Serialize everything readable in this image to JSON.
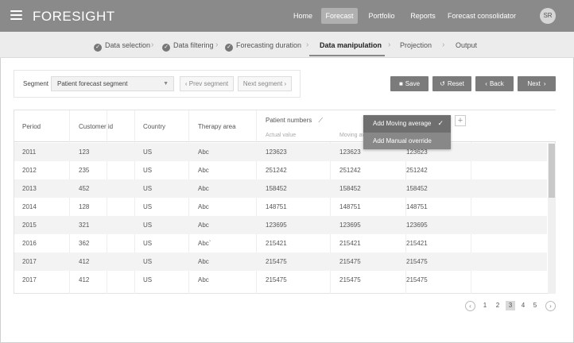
{
  "app": {
    "logo": "FORESIGHT",
    "avatar_initials": "SR"
  },
  "nav": [
    {
      "label": "Home"
    },
    {
      "label": "Forecast",
      "active": true
    },
    {
      "label": "Portfolio"
    },
    {
      "label": "Reports"
    },
    {
      "label": "Forecast consolidator"
    }
  ],
  "steps": [
    {
      "label": "Data selection",
      "done": true
    },
    {
      "label": "Data filtering",
      "done": true
    },
    {
      "label": "Forecasting duration",
      "done": true
    },
    {
      "label": "Data manipulation",
      "current": true
    },
    {
      "label": "Projection"
    },
    {
      "label": "Output"
    }
  ],
  "segment": {
    "label": "Segment",
    "selected": "Patient forecast segment",
    "prev": "Prev segment",
    "next": "Next segment"
  },
  "actions": {
    "save": "Save",
    "reset": "Reset",
    "back": "Back",
    "next": "Next"
  },
  "table": {
    "columns": [
      "Period",
      "Customer id",
      "Country",
      "Therapy area"
    ],
    "group_header": "Patient numbers",
    "sub_columns": [
      "Actual value",
      "Moving av"
    ],
    "rows": [
      [
        "2011",
        "123",
        "US",
        "Abc",
        "123623",
        "123623",
        "123623"
      ],
      [
        "2012",
        "235",
        "US",
        "Abc",
        "251242",
        "251242",
        "251242"
      ],
      [
        "2013",
        "452",
        "US",
        "Abc",
        "158452",
        "158452",
        "158452"
      ],
      [
        "2014",
        "128",
        "US",
        "Abc",
        "148751",
        "148751",
        "148751"
      ],
      [
        "2015",
        "321",
        "US",
        "Abc",
        "123695",
        "123695",
        "123695"
      ],
      [
        "2016",
        "362",
        "US",
        "Abc`",
        "215421",
        "215421",
        "215421"
      ],
      [
        "2017",
        "412",
        "US",
        "Abc",
        "215475",
        "215475",
        "215475"
      ],
      [
        "2017",
        "412",
        "US",
        "Abc",
        "215475",
        "215475",
        "215475"
      ]
    ]
  },
  "dropdown": {
    "items": [
      "Add Moving average",
      "Add Manual override"
    ]
  },
  "pagination": {
    "pages": [
      "1",
      "2",
      "3",
      "4",
      "5"
    ],
    "current": "3"
  },
  "icons": {
    "trend": "trend-icon",
    "plus": "plus-icon"
  }
}
